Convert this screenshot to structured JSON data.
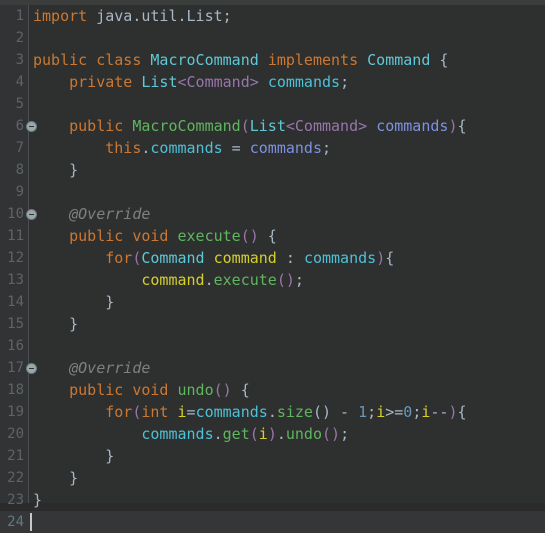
{
  "editor": {
    "language": "java",
    "file_type": "Java source",
    "colors": {
      "background": "#2e2f2f",
      "gutter_background": "#313335",
      "current_line_background": "#353637",
      "line_number": "#606366",
      "default_text": "#a9b7c6",
      "keyword": "#cc7832",
      "type": "#5ec9d8",
      "generic_arg": "#9876aa",
      "method": "#5fb65f",
      "field": "#4fc1d6",
      "parameter": "#7d92e0",
      "local_variable": "#d6d02a",
      "number": "#6897bb",
      "annotation": "#808080",
      "caret": "#c8c8c8"
    },
    "caret_line": 24,
    "caret_column": 1,
    "total_lines": 24,
    "lines": [
      {
        "number": "1",
        "fold": false,
        "tokens": [
          {
            "text": "import",
            "cls": "t-kw"
          },
          {
            "text": " java.util.List;",
            "cls": "t-plain"
          }
        ]
      },
      {
        "number": "2",
        "fold": false,
        "tokens": []
      },
      {
        "number": "3",
        "fold": false,
        "tokens": [
          {
            "text": "public class",
            "cls": "t-kw"
          },
          {
            "text": " ",
            "cls": "t-plain"
          },
          {
            "text": "MacroCommand",
            "cls": "t-type"
          },
          {
            "text": " ",
            "cls": "t-plain"
          },
          {
            "text": "implements",
            "cls": "t-kw"
          },
          {
            "text": " ",
            "cls": "t-plain"
          },
          {
            "text": "Command",
            "cls": "t-type"
          },
          {
            "text": " {",
            "cls": "t-br1"
          }
        ]
      },
      {
        "number": "4",
        "fold": false,
        "tokens": [
          {
            "text": "    ",
            "cls": "t-plain"
          },
          {
            "text": "private",
            "cls": "t-kw"
          },
          {
            "text": " ",
            "cls": "t-plain"
          },
          {
            "text": "List",
            "cls": "t-type"
          },
          {
            "text": "<",
            "cls": "t-br2"
          },
          {
            "text": "Command",
            "cls": "t-generic"
          },
          {
            "text": ">",
            "cls": "t-br2"
          },
          {
            "text": " ",
            "cls": "t-plain"
          },
          {
            "text": "commands",
            "cls": "t-field"
          },
          {
            "text": ";",
            "cls": "t-plain"
          }
        ]
      },
      {
        "number": "5",
        "fold": false,
        "tokens": []
      },
      {
        "number": "6",
        "fold": true,
        "tokens": [
          {
            "text": "    ",
            "cls": "t-plain"
          },
          {
            "text": "public",
            "cls": "t-kw"
          },
          {
            "text": " ",
            "cls": "t-plain"
          },
          {
            "text": "MacroCommand",
            "cls": "t-method"
          },
          {
            "text": "(",
            "cls": "t-br2"
          },
          {
            "text": "List",
            "cls": "t-type"
          },
          {
            "text": "<",
            "cls": "t-br2"
          },
          {
            "text": "Command",
            "cls": "t-generic"
          },
          {
            "text": ">",
            "cls": "t-br2"
          },
          {
            "text": " ",
            "cls": "t-plain"
          },
          {
            "text": "commands",
            "cls": "t-param"
          },
          {
            "text": ")",
            "cls": "t-br2"
          },
          {
            "text": "{",
            "cls": "t-br1"
          }
        ]
      },
      {
        "number": "7",
        "fold": false,
        "tokens": [
          {
            "text": "        ",
            "cls": "t-plain"
          },
          {
            "text": "this",
            "cls": "t-kw"
          },
          {
            "text": ".",
            "cls": "t-plain"
          },
          {
            "text": "commands",
            "cls": "t-field"
          },
          {
            "text": " = ",
            "cls": "t-plain"
          },
          {
            "text": "commands",
            "cls": "t-param"
          },
          {
            "text": ";",
            "cls": "t-plain"
          }
        ]
      },
      {
        "number": "8",
        "fold": false,
        "tokens": [
          {
            "text": "    }",
            "cls": "t-br1"
          }
        ]
      },
      {
        "number": "9",
        "fold": false,
        "tokens": []
      },
      {
        "number": "10",
        "fold": true,
        "tokens": [
          {
            "text": "    ",
            "cls": "t-plain"
          },
          {
            "text": "@Override",
            "cls": "t-anno"
          }
        ]
      },
      {
        "number": "11",
        "fold": false,
        "tokens": [
          {
            "text": "    ",
            "cls": "t-plain"
          },
          {
            "text": "public void",
            "cls": "t-kw"
          },
          {
            "text": " ",
            "cls": "t-plain"
          },
          {
            "text": "execute",
            "cls": "t-method"
          },
          {
            "text": "()",
            "cls": "t-br2"
          },
          {
            "text": " {",
            "cls": "t-br1"
          }
        ]
      },
      {
        "number": "12",
        "fold": false,
        "tokens": [
          {
            "text": "        ",
            "cls": "t-plain"
          },
          {
            "text": "for",
            "cls": "t-kw"
          },
          {
            "text": "(",
            "cls": "t-br2"
          },
          {
            "text": "Command",
            "cls": "t-type"
          },
          {
            "text": " ",
            "cls": "t-plain"
          },
          {
            "text": "command",
            "cls": "t-local"
          },
          {
            "text": " : ",
            "cls": "t-plain"
          },
          {
            "text": "commands",
            "cls": "t-field"
          },
          {
            "text": ")",
            "cls": "t-br2"
          },
          {
            "text": "{",
            "cls": "t-br1"
          }
        ]
      },
      {
        "number": "13",
        "fold": false,
        "tokens": [
          {
            "text": "            ",
            "cls": "t-plain"
          },
          {
            "text": "command",
            "cls": "t-local"
          },
          {
            "text": ".",
            "cls": "t-plain"
          },
          {
            "text": "execute",
            "cls": "t-method"
          },
          {
            "text": "()",
            "cls": "t-br2"
          },
          {
            "text": ";",
            "cls": "t-plain"
          }
        ]
      },
      {
        "number": "14",
        "fold": false,
        "tokens": [
          {
            "text": "        }",
            "cls": "t-br1"
          }
        ]
      },
      {
        "number": "15",
        "fold": false,
        "tokens": [
          {
            "text": "    }",
            "cls": "t-br1"
          }
        ]
      },
      {
        "number": "16",
        "fold": false,
        "tokens": []
      },
      {
        "number": "17",
        "fold": true,
        "tokens": [
          {
            "text": "    ",
            "cls": "t-plain"
          },
          {
            "text": "@Override",
            "cls": "t-anno"
          }
        ]
      },
      {
        "number": "18",
        "fold": false,
        "tokens": [
          {
            "text": "    ",
            "cls": "t-plain"
          },
          {
            "text": "public void",
            "cls": "t-kw"
          },
          {
            "text": " ",
            "cls": "t-plain"
          },
          {
            "text": "undo",
            "cls": "t-method"
          },
          {
            "text": "()",
            "cls": "t-br2"
          },
          {
            "text": " {",
            "cls": "t-br1"
          }
        ]
      },
      {
        "number": "19",
        "fold": false,
        "tokens": [
          {
            "text": "        ",
            "cls": "t-plain"
          },
          {
            "text": "for",
            "cls": "t-kw"
          },
          {
            "text": "(",
            "cls": "t-br2"
          },
          {
            "text": "int",
            "cls": "t-kw"
          },
          {
            "text": " ",
            "cls": "t-plain"
          },
          {
            "text": "i",
            "cls": "t-local"
          },
          {
            "text": "=",
            "cls": "t-plain"
          },
          {
            "text": "commands",
            "cls": "t-field"
          },
          {
            "text": ".",
            "cls": "t-plain"
          },
          {
            "text": "size",
            "cls": "t-method"
          },
          {
            "text": "()",
            "cls": "t-br1"
          },
          {
            "text": " - ",
            "cls": "t-plain"
          },
          {
            "text": "1",
            "cls": "t-num"
          },
          {
            "text": ";",
            "cls": "t-plain"
          },
          {
            "text": "i",
            "cls": "t-local"
          },
          {
            "text": ">=",
            "cls": "t-plain"
          },
          {
            "text": "0",
            "cls": "t-num"
          },
          {
            "text": ";",
            "cls": "t-plain"
          },
          {
            "text": "i",
            "cls": "t-local"
          },
          {
            "text": "--",
            "cls": "t-plain"
          },
          {
            "text": ")",
            "cls": "t-br2"
          },
          {
            "text": "{",
            "cls": "t-br1"
          }
        ]
      },
      {
        "number": "20",
        "fold": false,
        "tokens": [
          {
            "text": "            ",
            "cls": "t-plain"
          },
          {
            "text": "commands",
            "cls": "t-field"
          },
          {
            "text": ".",
            "cls": "t-plain"
          },
          {
            "text": "get",
            "cls": "t-method"
          },
          {
            "text": "(",
            "cls": "t-br2"
          },
          {
            "text": "i",
            "cls": "t-local"
          },
          {
            "text": ")",
            "cls": "t-br2"
          },
          {
            "text": ".",
            "cls": "t-plain"
          },
          {
            "text": "undo",
            "cls": "t-method"
          },
          {
            "text": "()",
            "cls": "t-br2"
          },
          {
            "text": ";",
            "cls": "t-plain"
          }
        ]
      },
      {
        "number": "21",
        "fold": false,
        "tokens": [
          {
            "text": "        }",
            "cls": "t-br1"
          }
        ]
      },
      {
        "number": "22",
        "fold": false,
        "tokens": [
          {
            "text": "    }",
            "cls": "t-br1"
          }
        ]
      },
      {
        "number": "23",
        "fold": false,
        "tokens": [
          {
            "text": "}",
            "cls": "t-br1"
          }
        ]
      },
      {
        "number": "24",
        "fold": false,
        "current": true,
        "tokens": []
      }
    ]
  }
}
